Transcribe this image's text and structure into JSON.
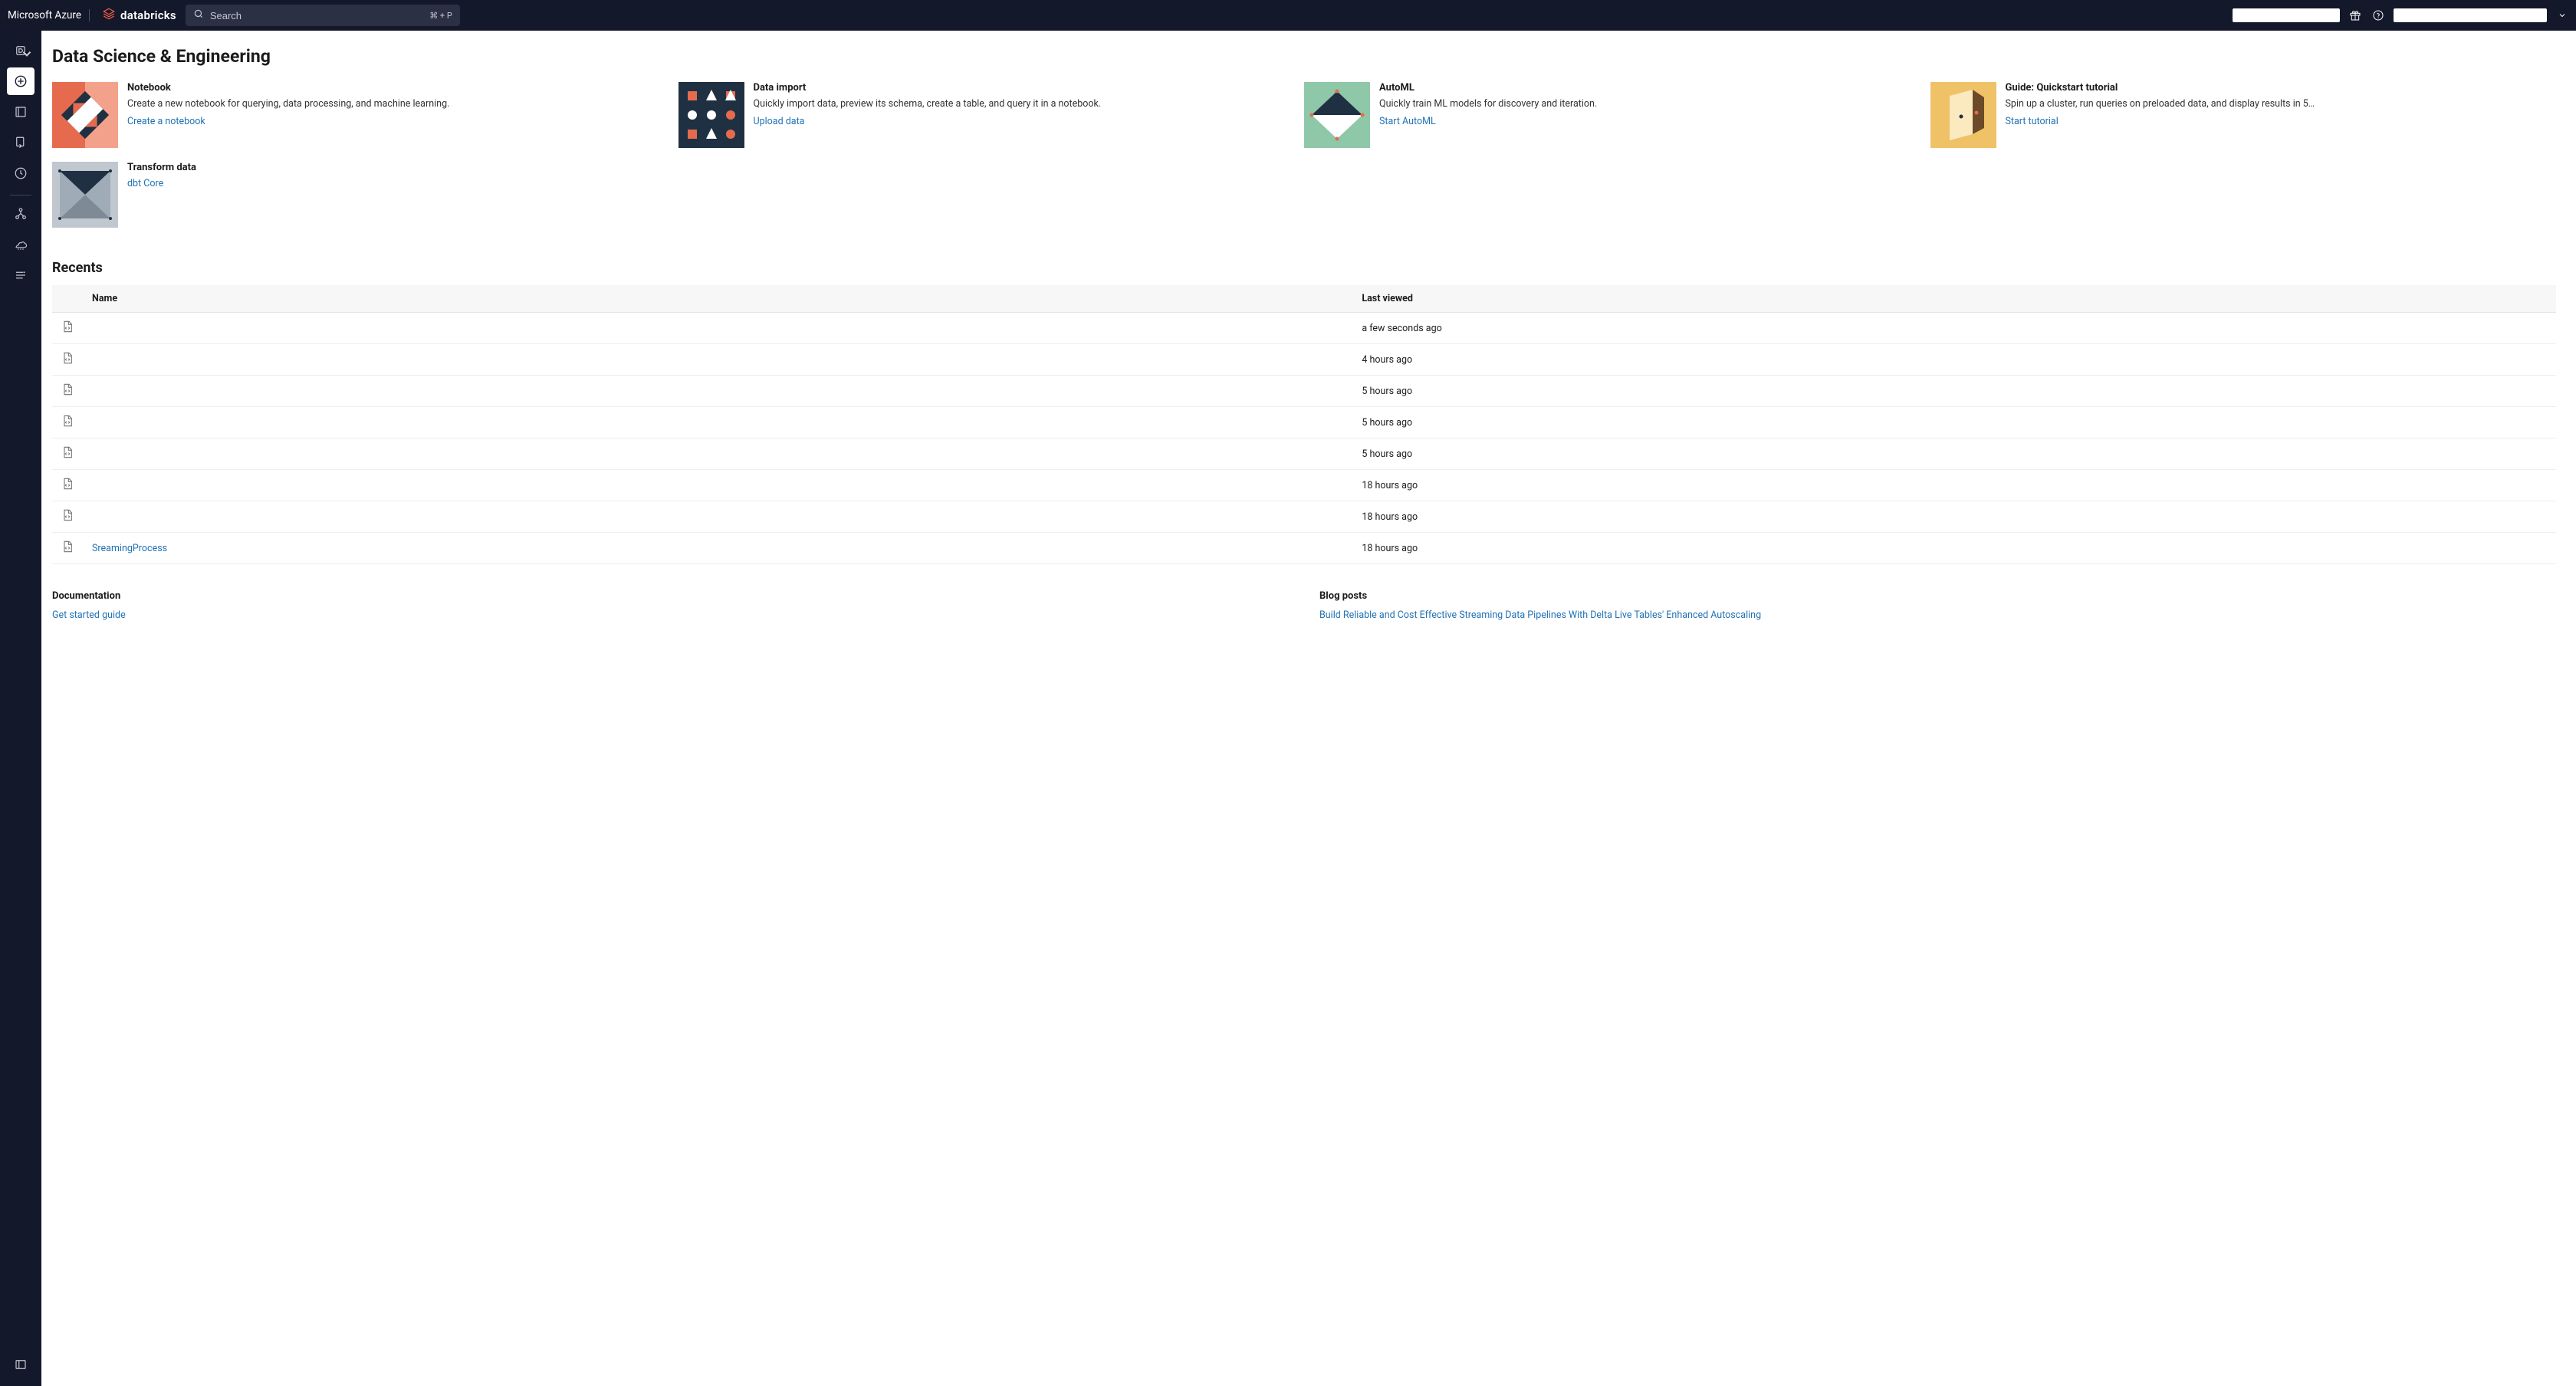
{
  "topbar": {
    "cloud_brand": "Microsoft Azure",
    "product_brand": "databricks",
    "search_placeholder": "Search",
    "search_shortcut": "⌘ + P"
  },
  "page": {
    "title": "Data Science & Engineering"
  },
  "cards": [
    {
      "title": "Notebook",
      "desc": "Create a new notebook for querying, data processing, and machine learning.",
      "link": "Create a notebook",
      "thumb": "notebook"
    },
    {
      "title": "Data import",
      "desc": "Quickly import data, preview its schema, create a table, and query it in a notebook.",
      "link": "Upload data",
      "thumb": "import"
    },
    {
      "title": "AutoML",
      "desc": "Quickly train ML models for discovery and iteration.",
      "link": "Start AutoML",
      "thumb": "automl"
    },
    {
      "title": "Guide: Quickstart tutorial",
      "desc": "Spin up a cluster, run queries on preloaded data, and display results in 5…",
      "link": "Start tutorial",
      "thumb": "guide"
    },
    {
      "title": "Transform data",
      "desc": "",
      "link": "dbt Core",
      "thumb": "transform"
    }
  ],
  "recents": {
    "heading": "Recents",
    "columns": [
      "Name",
      "Last viewed"
    ],
    "rows": [
      {
        "name": "",
        "last": "a few seconds ago",
        "is_link": false
      },
      {
        "name": "",
        "last": "4 hours ago",
        "is_link": false
      },
      {
        "name": "",
        "last": "5 hours ago",
        "is_link": false
      },
      {
        "name": "",
        "last": "5 hours ago",
        "is_link": false
      },
      {
        "name": "",
        "last": "5 hours ago",
        "is_link": false
      },
      {
        "name": "",
        "last": "18 hours ago",
        "is_link": false
      },
      {
        "name": "",
        "last": "18 hours ago",
        "is_link": false
      },
      {
        "name": "SreamingProcess",
        "last": "18 hours ago",
        "is_link": true
      }
    ]
  },
  "documentation": {
    "heading": "Documentation",
    "links": [
      "Get started guide"
    ]
  },
  "blog": {
    "heading": "Blog posts",
    "links": [
      "Build Reliable and Cost Effective Streaming Data Pipelines With Delta Live Tables' Enhanced Autoscaling"
    ]
  }
}
